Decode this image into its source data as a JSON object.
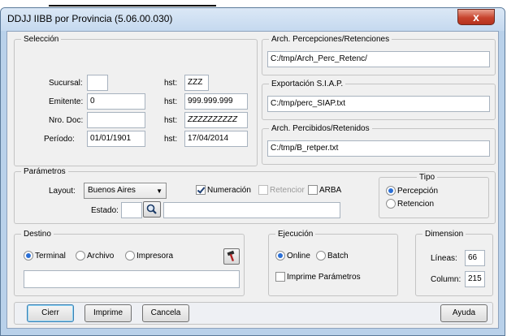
{
  "window": {
    "title": "DDJJ IIBB por Provincia (5.06.00.030)",
    "close_glyph": "x"
  },
  "seleccion": {
    "legend": "Selección",
    "sucursal": {
      "label": "Sucursal:",
      "from": "",
      "to_label": "hst:",
      "to": "ZZZ"
    },
    "emitente": {
      "label": "Emitente:",
      "from": "0",
      "to_label": "hst:",
      "to": "999.999.999"
    },
    "nro_doc": {
      "label": "Nro. Doc:",
      "from": "",
      "to_label": "hst:",
      "to": "ZZZZZZZZZZ"
    },
    "periodo": {
      "label": "Período:",
      "from": "01/01/1901",
      "to_label": "hst:",
      "to": "17/04/2014"
    }
  },
  "percepciones": {
    "legend": "Arch. Percepciones/Retenciones",
    "value": "C:/tmp/Arch_Perc_Retenc/"
  },
  "exportacion": {
    "legend": "Exportación S.I.A.P.",
    "value": "C:/tmp/perc_SIAP.txt"
  },
  "percibidos": {
    "legend": "Arch. Percibidos/Retenidos",
    "value": "C:/tmp/B_retper.txt"
  },
  "parametros": {
    "legend": "Parámetros",
    "layout_label": "Layout:",
    "layout_value": "Buenos Aires",
    "numeracion": {
      "label": "Numeración",
      "checked": true
    },
    "retencion": {
      "label": "Retencior",
      "checked": false,
      "enabled": false
    },
    "arba": {
      "label": "ARBA",
      "checked": false
    },
    "estado_label": "Estado:",
    "estado_value": "",
    "estado_desc": ""
  },
  "tipo": {
    "legend": "Tipo",
    "options": [
      {
        "label": "Percepción",
        "selected": true
      },
      {
        "label": "Retencion",
        "selected": false
      }
    ]
  },
  "destino": {
    "legend": "Destino",
    "options": [
      {
        "label": "Terminal",
        "selected": true
      },
      {
        "label": "Archivo",
        "selected": false
      },
      {
        "label": "Impresora",
        "selected": false
      }
    ],
    "value": ""
  },
  "ejecucion": {
    "legend": "Ejecución",
    "options": [
      {
        "label": "Online",
        "selected": true
      },
      {
        "label": "Batch",
        "selected": false
      }
    ],
    "imprime": {
      "label": "Imprime Parámetros",
      "checked": false
    }
  },
  "dimension": {
    "legend": "Dimension",
    "lineas_label": "Líneas:",
    "lineas": "66",
    "column_label": "Column:",
    "column": "215"
  },
  "buttons": {
    "cierre": "Cierr",
    "imprime": "Imprime",
    "cancela": "Cancela",
    "ayuda": "Ayuda"
  }
}
